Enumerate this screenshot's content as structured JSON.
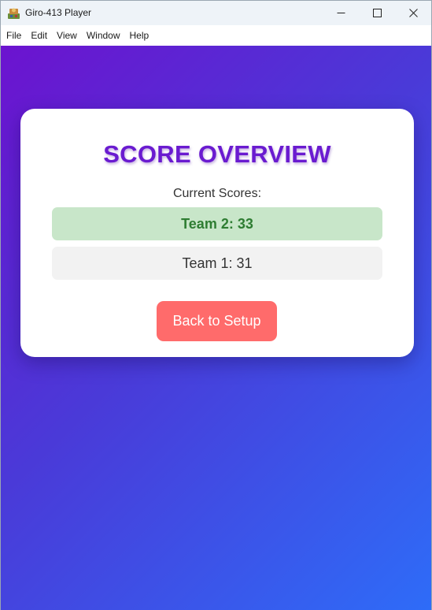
{
  "window": {
    "title": "Giro-413 Player",
    "icon": "app-logo-icon"
  },
  "menubar": {
    "items": [
      "File",
      "Edit",
      "View",
      "Window",
      "Help"
    ]
  },
  "card": {
    "title": "SCORE OVERVIEW",
    "scores_label": "Current Scores:",
    "scores": [
      {
        "text": "Team 2: 33",
        "highlight": true
      },
      {
        "text": "Team 1: 31",
        "highlight": false
      }
    ],
    "back_button_label": "Back to Setup"
  },
  "colors": {
    "title": "#6a1bd0",
    "leader_bg": "#c8e6c9",
    "leader_text": "#2e7d32",
    "button_bg": "#ff6b6b",
    "gradient_start": "#6c13cf",
    "gradient_end": "#2e6cf8"
  }
}
